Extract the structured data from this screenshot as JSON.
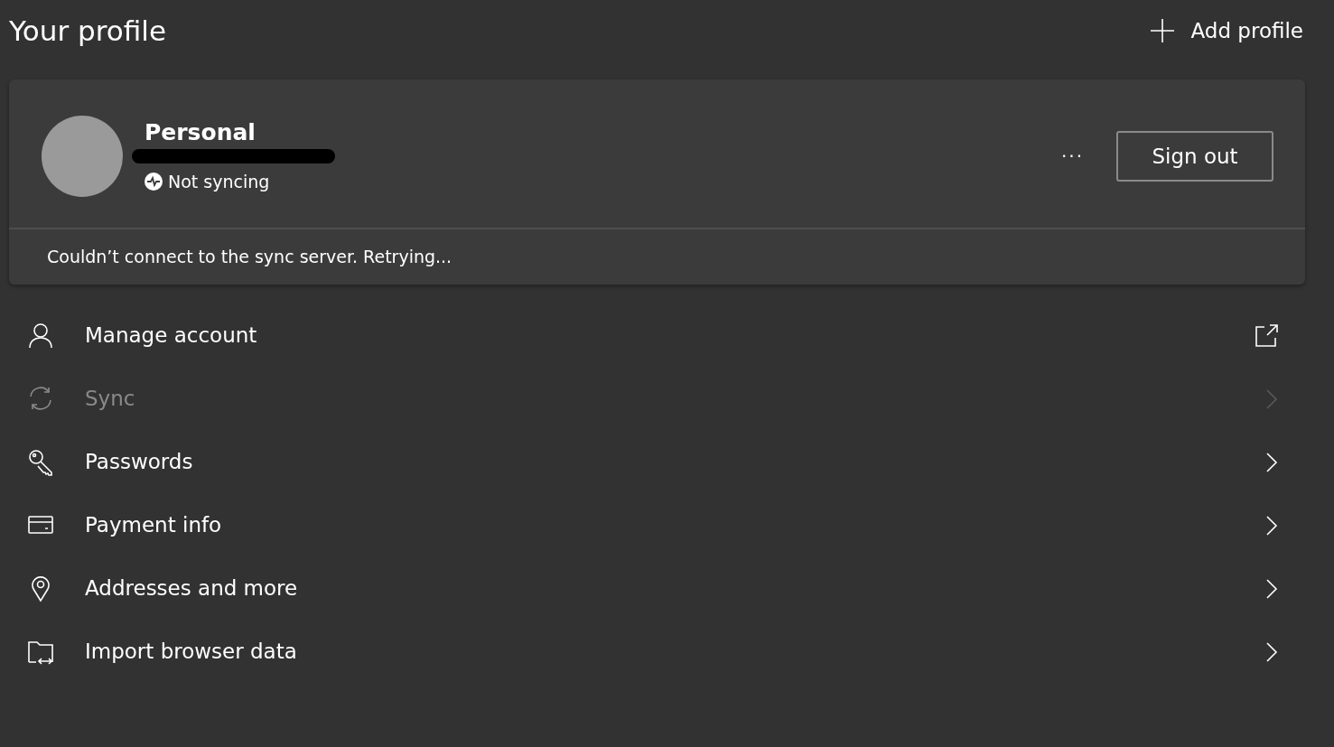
{
  "header": {
    "title": "Your profile",
    "add_profile": "Add profile"
  },
  "profile": {
    "name": "Personal",
    "sync_status": "Not syncing",
    "more": "···",
    "sign_out": "Sign out",
    "message": "Couldn’t connect to the sync server. Retrying..."
  },
  "menu": [
    {
      "label": "Manage account",
      "kind": "external",
      "disabled": false
    },
    {
      "label": "Sync",
      "kind": "chevron",
      "disabled": true
    },
    {
      "label": "Passwords",
      "kind": "chevron",
      "disabled": false
    },
    {
      "label": "Payment info",
      "kind": "chevron",
      "disabled": false
    },
    {
      "label": "Addresses and more",
      "kind": "chevron",
      "disabled": false
    },
    {
      "label": "Import browser data",
      "kind": "chevron",
      "disabled": false
    }
  ]
}
